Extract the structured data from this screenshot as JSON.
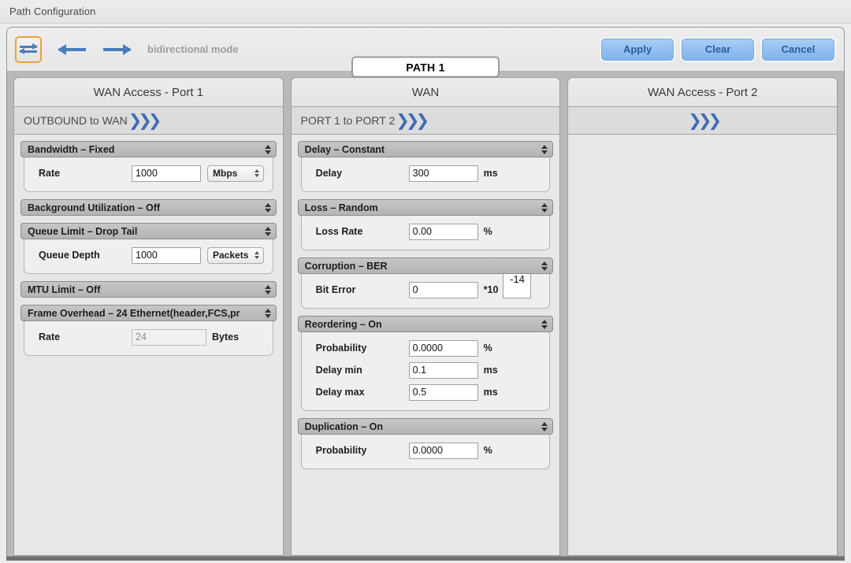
{
  "window": {
    "title": "Path Configuration"
  },
  "toolbar": {
    "mode_icon": "bidirectional-arrows-icon",
    "mode_label": "bidirectional mode",
    "path_name": "PATH 1",
    "buttons": [
      {
        "label": "Apply",
        "name": "apply-button"
      },
      {
        "label": "Clear",
        "name": "clear-button"
      },
      {
        "label": "Cancel",
        "name": "cancel-button"
      }
    ],
    "accent_orange": "#e9a33c",
    "accent_blue": "#4a7ebb",
    "button_blue": "#7fb3ee",
    "button_text_blue": "#2b5d9b"
  },
  "columns": [
    {
      "title": "WAN Access - Port 1",
      "subtitle": "OUTBOUND to WAN",
      "chevron": "»›",
      "subtitle_centered": false,
      "sections": [
        {
          "header": "Bandwidth – Fixed",
          "name": "bandwidth-section",
          "rows": [
            {
              "label": "Rate",
              "value": "1000",
              "input_width": "w88",
              "unit": "",
              "popup": "Mbps",
              "disabled": false
            }
          ]
        },
        {
          "header": "Background Utilization – Off",
          "name": "background-utilization-section",
          "rows": []
        },
        {
          "header": "Queue Limit – Drop Tail",
          "name": "queue-limit-section",
          "rows": [
            {
              "label": "Queue Depth",
              "value": "1000",
              "input_width": "w88",
              "unit": "",
              "popup": "Packets",
              "disabled": false
            }
          ]
        },
        {
          "header": "MTU Limit – Off",
          "name": "mtu-limit-section",
          "rows": []
        },
        {
          "header": "Frame Overhead – 24 Ethernet(header,FCS,pr",
          "name": "frame-overhead-section",
          "rows": [
            {
              "label": "Rate",
              "value": "24",
              "input_width": "w95",
              "unit": "Bytes",
              "popup": "",
              "disabled": true
            }
          ]
        }
      ]
    },
    {
      "title": "WAN",
      "subtitle": "PORT 1 to PORT 2",
      "chevron": "»›",
      "subtitle_centered": false,
      "sections": [
        {
          "header": "Delay – Constant",
          "name": "delay-section",
          "rows": [
            {
              "label": "Delay",
              "value": "300",
              "input_width": "w88",
              "unit": "ms",
              "popup": "",
              "disabled": false
            }
          ]
        },
        {
          "header": "Loss – Random",
          "name": "loss-section",
          "rows": [
            {
              "label": "Loss Rate",
              "value": "0.00",
              "input_width": "w88",
              "unit": "%",
              "popup": "",
              "disabled": false
            }
          ]
        },
        {
          "header": "Corruption – BER",
          "name": "corruption-section",
          "rows": [
            {
              "label": "Bit Error",
              "value": "0",
              "input_width": "w88",
              "unit": "*10",
              "popup": "",
              "exponent": "-14",
              "disabled": false
            }
          ]
        },
        {
          "header": "Reordering – On",
          "name": "reordering-section",
          "rows": [
            {
              "label": "Probability",
              "value": "0.0000",
              "input_width": "w88",
              "unit": "%",
              "popup": "",
              "disabled": false
            },
            {
              "label": "Delay min",
              "value": "0.1",
              "input_width": "w88",
              "unit": "ms",
              "popup": "",
              "disabled": false
            },
            {
              "label": "Delay max",
              "value": "0.5",
              "input_width": "w88",
              "unit": "ms",
              "popup": "",
              "disabled": false
            }
          ]
        },
        {
          "header": "Duplication – On",
          "name": "duplication-section",
          "rows": [
            {
              "label": "Probability",
              "value": "0.0000",
              "input_width": "w88",
              "unit": "%",
              "popup": "",
              "disabled": false
            }
          ]
        }
      ]
    },
    {
      "title": "WAN Access - Port 2",
      "subtitle": "",
      "chevron": "»›",
      "subtitle_centered": true,
      "sections": []
    }
  ]
}
